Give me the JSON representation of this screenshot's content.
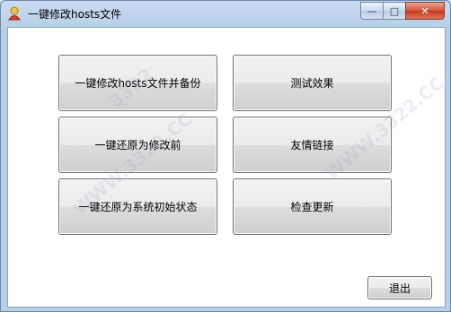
{
  "window": {
    "title": "一键修改hosts文件",
    "controls": {
      "minimize": "—",
      "maximize": "□",
      "close": "✕"
    }
  },
  "buttons": {
    "modify_backup": "一键修改hosts文件并备份",
    "test_effect": "测试效果",
    "restore_previous": "一键还原为修改前",
    "friendly_links": "友情链接",
    "restore_initial": "一键还原为系统初始状态",
    "check_update": "检查更新",
    "exit": "退出"
  }
}
